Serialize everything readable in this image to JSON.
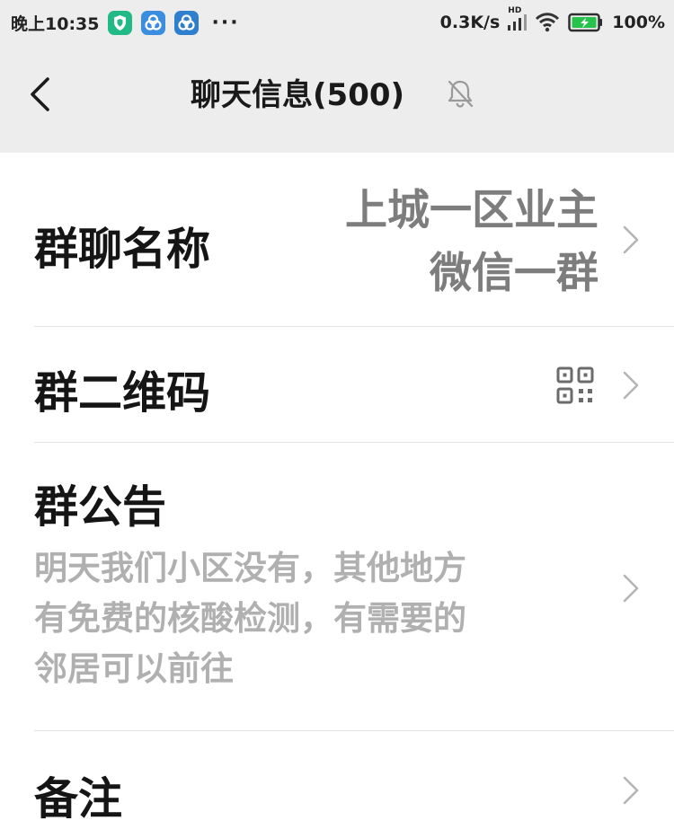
{
  "status_bar": {
    "time": "晚上10:35",
    "more": "···",
    "net_speed": "0.3K/s",
    "signal_tag": "HD",
    "battery": "100%",
    "colors": {
      "app1": "#21b985",
      "app2": "#3b8de0",
      "app3": "#2f7fcf"
    }
  },
  "header": {
    "back_icon": "chevron-left-icon",
    "title": "聊天信息(500)",
    "mute_icon": "bell-off-icon"
  },
  "rows": {
    "group_name": {
      "label": "群聊名称",
      "value_line1": "上城一区业主",
      "value_line2": "微信一群"
    },
    "qr_code": {
      "label": "群二维码",
      "icon": "qr-code-icon"
    },
    "notice": {
      "label": "群公告",
      "line1": "明天我们小区没有，其他地方",
      "line2": "有免费的核酸检测，有需要的",
      "line3": "邻居可以前往"
    },
    "remark": {
      "label": "备注"
    }
  }
}
